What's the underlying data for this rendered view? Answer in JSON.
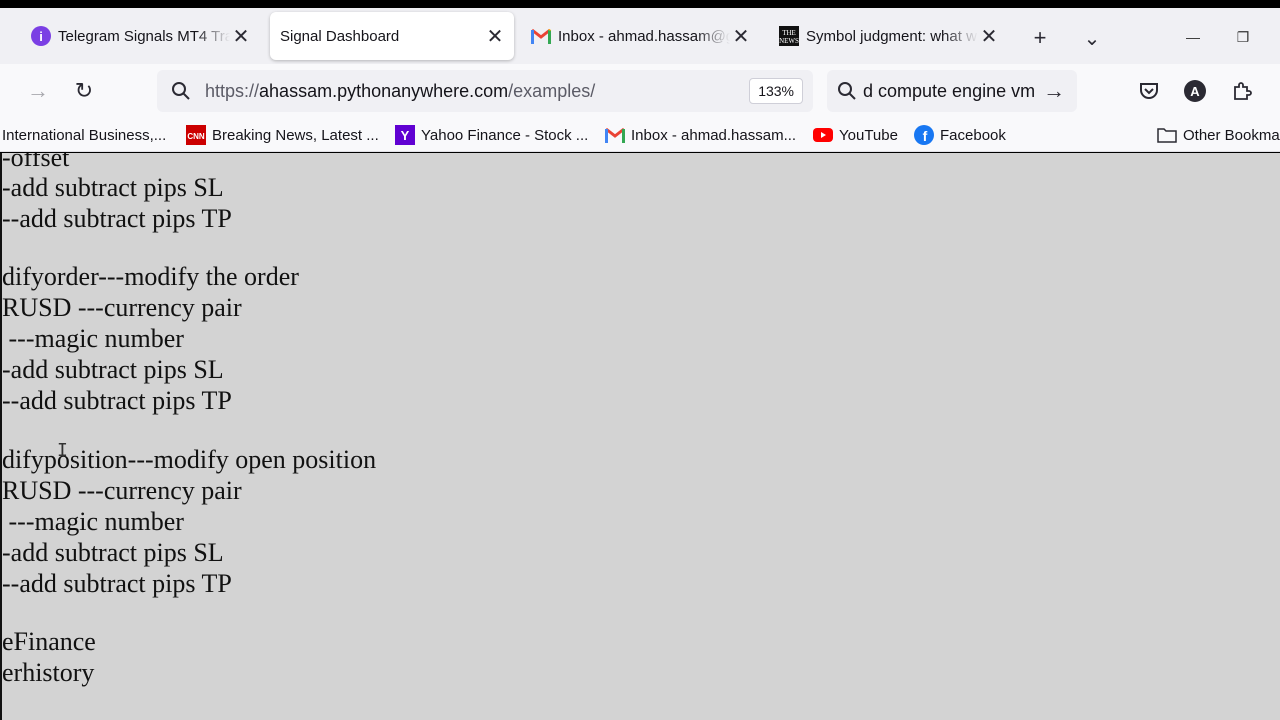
{
  "tabs": [
    {
      "title": "Telegram Signals MT4 Tra",
      "favicon": "telegram-purple-icon",
      "active": false
    },
    {
      "title": "Signal Dashboard",
      "favicon": "",
      "active": true
    },
    {
      "title": "Inbox - ahmad.hassam@g",
      "favicon": "gmail-icon",
      "active": false
    },
    {
      "title": "Symbol judgment: what w",
      "favicon": "the-news-icon",
      "active": false
    }
  ],
  "tab_close_glyph": "✕",
  "new_tab_glyph": "+",
  "tab_list_glyph": "⌄",
  "window": {
    "minimize_glyph": "—",
    "restore_glyph": "❐"
  },
  "nav": {
    "forward_glyph": "→",
    "reload_glyph": "↻",
    "url_prefix": "https://",
    "url_host": "ahassam.pythonanywhere.com",
    "url_path": "/examples/",
    "zoom": "133%",
    "search_query": "d compute engine vm",
    "search_go_glyph": "→",
    "account_initial": "A"
  },
  "bookmarks": [
    {
      "label": "International Business,...",
      "icon": ""
    },
    {
      "label": "Breaking News, Latest ...",
      "icon": "cnn-icon"
    },
    {
      "label": "Yahoo Finance - Stock ...",
      "icon": "yahoo-icon"
    },
    {
      "label": "Inbox - ahmad.hassam...",
      "icon": "gmail-icon"
    },
    {
      "label": "YouTube",
      "icon": "youtube-icon"
    },
    {
      "label": "Facebook",
      "icon": "facebook-icon"
    },
    {
      "label": "Other Bookmarks",
      "icon": "folder-icon"
    }
  ],
  "content_lines": [
    "-offset",
    "-add subtract pips SL",
    "--add subtract pips TP",
    "difyorder---modify the order",
    "RUSD ---currency pair",
    " ---magic number",
    "-add subtract pips SL",
    "--add subtract pips TP",
    "difyposition---modify open position",
    "RUSD ---currency pair",
    " ---magic number",
    "-add subtract pips SL",
    "--add subtract pips TP",
    "eFinance",
    "erhistory"
  ],
  "colors": {
    "telegram": "#7b3fe4",
    "cnn": "#cc0000",
    "yahoo": "#6001d2",
    "youtube": "#ff0000",
    "facebook": "#1877f2",
    "page_bg": "#d3d3d3"
  }
}
